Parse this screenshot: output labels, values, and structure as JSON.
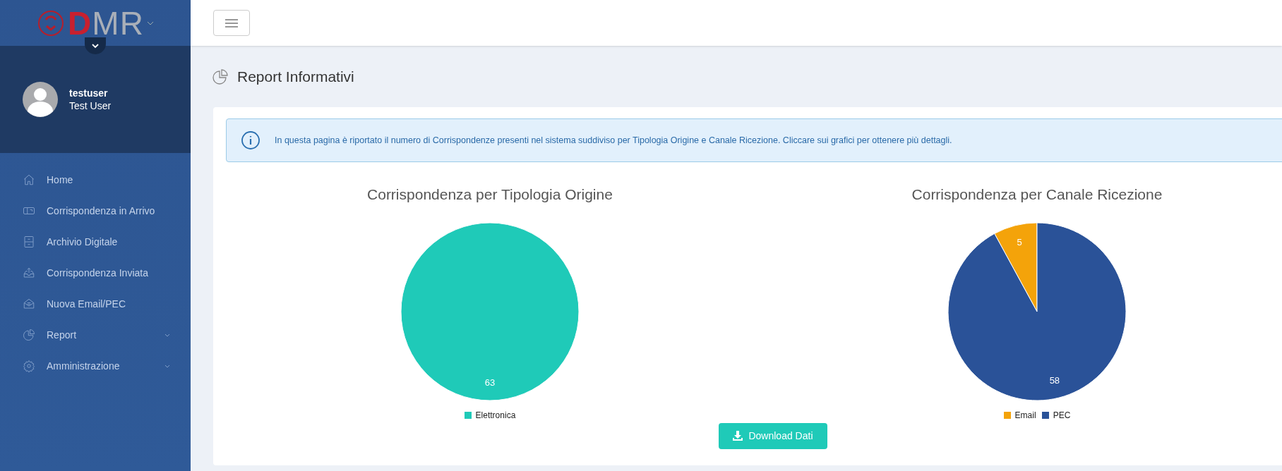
{
  "logo": {
    "accent": "D",
    "rest": "MR"
  },
  "user": {
    "username": "testuser",
    "full_name": "Test User"
  },
  "sidebar": {
    "items": [
      {
        "label": "Home",
        "has_submenu": false
      },
      {
        "label": "Corrispondenza in Arrivo",
        "has_submenu": false
      },
      {
        "label": "Archivio Digitale",
        "has_submenu": false
      },
      {
        "label": "Corrispondenza Inviata",
        "has_submenu": false
      },
      {
        "label": "Nuova Email/PEC",
        "has_submenu": false
      },
      {
        "label": "Report",
        "has_submenu": true
      },
      {
        "label": "Amministrazione",
        "has_submenu": true
      }
    ]
  },
  "page": {
    "title": "Report Informativi"
  },
  "info": {
    "text": "In questa pagina è riportato il numero di Corrispondenze presenti nel sistema suddiviso per Tipologia Origine e Canale Ricezione. Cliccare sui grafici per ottenere più dettagli."
  },
  "charts": [
    {
      "chart_data": {
        "type": "pie",
        "title": "Corrispondenza per Tipologia Origine",
        "categories": [
          "Elettronica"
        ],
        "values": [
          63
        ],
        "colors": [
          "#1fcab8"
        ],
        "data_labels": true,
        "legend": "bottom"
      }
    },
    {
      "chart_data": {
        "type": "pie",
        "title": "Corrispondenza per Canale Ricezione",
        "categories": [
          "Email",
          "PEC"
        ],
        "values": [
          5,
          58
        ],
        "colors": [
          "#f4a30a",
          "#2a5298"
        ],
        "data_labels": true,
        "legend": "bottom"
      }
    }
  ],
  "download_button": {
    "label": "Download Dati"
  }
}
